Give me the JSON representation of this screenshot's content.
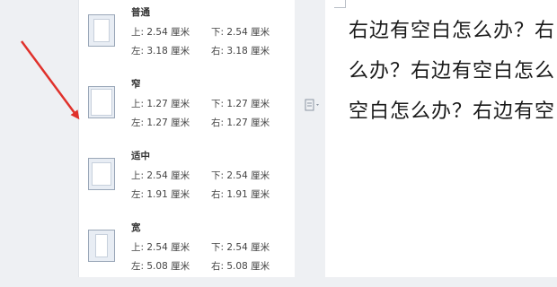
{
  "margins_menu": {
    "presets": [
      {
        "name": "普通",
        "top": "上: 2.54 厘米",
        "bottom": "下: 2.54 厘米",
        "left": "左: 3.18 厘米",
        "right": "右: 3.18 厘米"
      },
      {
        "name": "窄",
        "top": "上: 1.27 厘米",
        "bottom": "下: 1.27 厘米",
        "left": "左: 1.27 厘米",
        "right": "右: 1.27 厘米"
      },
      {
        "name": "适中",
        "top": "上: 2.54 厘米",
        "bottom": "下: 2.54 厘米",
        "left": "左: 1.91 厘米",
        "right": "右: 1.91 厘米"
      },
      {
        "name": "宽",
        "top": "上: 2.54 厘米",
        "bottom": "下: 2.54 厘米",
        "left": "左: 5.08 厘米",
        "right": "右: 5.08 厘米"
      }
    ]
  },
  "document": {
    "lines": [
      "右边有空白怎么办？右",
      "么办？右边有空白怎么",
      "空白怎么办？右边有空"
    ]
  },
  "colors": {
    "arrow": "#e0312b",
    "menu_bg": "#ffffff",
    "workspace_bg": "#eef0f3"
  }
}
